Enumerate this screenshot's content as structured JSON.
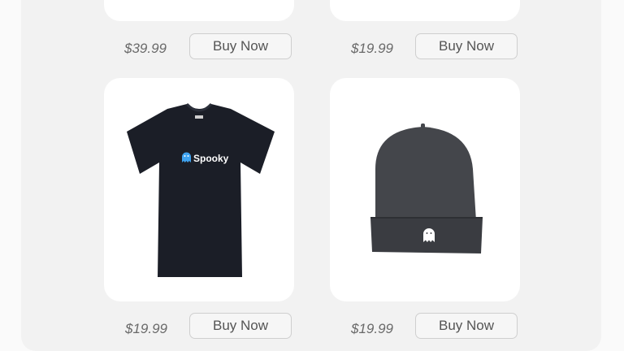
{
  "products": [
    {
      "price": "$39.99",
      "button_label": "Buy Now"
    },
    {
      "price": "$19.99",
      "button_label": "Buy Now"
    },
    {
      "price": "$19.99",
      "button_label": "Buy Now",
      "image": "tshirt-image",
      "logo_text": "Spooky"
    },
    {
      "price": "$19.99",
      "button_label": "Buy Now",
      "image": "beanie-image"
    }
  ],
  "colors": {
    "logo_blue": "#3fa3f0",
    "shirt": "#1b1e27",
    "beanie": "#44464b"
  }
}
